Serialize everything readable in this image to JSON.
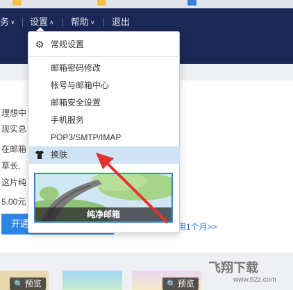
{
  "nav": {
    "items": [
      {
        "label": "务",
        "chevron": true
      },
      {
        "label": "设置",
        "chevron": true
      },
      {
        "label": "帮助",
        "chevron": true
      },
      {
        "label": "退出",
        "chevron": false
      }
    ]
  },
  "dropdown": {
    "items": [
      {
        "label": "常规设置",
        "icon": "gear-icon",
        "highlighted": false
      },
      {
        "label": "邮箱密码修改",
        "icon": "",
        "highlighted": false
      },
      {
        "label": "帐号与邮箱中心",
        "icon": "",
        "highlighted": false
      },
      {
        "label": "邮箱安全设置",
        "icon": "",
        "highlighted": false
      },
      {
        "label": "手机服务",
        "icon": "",
        "highlighted": false
      },
      {
        "label": "POP3/SMTP/IMAP",
        "icon": "",
        "highlighted": false
      },
      {
        "label": "换肤",
        "icon": "tshirt-icon",
        "highlighted": true
      }
    ],
    "skin_preview": {
      "caption": "纯净邮箱"
    }
  },
  "main": {
    "lines": [
      "理想中",
      "现实总",
      "在邮箱",
      "草长,",
      "这片纯"
    ],
    "price": "5.00元",
    "open_button": "开通",
    "trial_link": "用1个月>>"
  },
  "thumbnails": {
    "preview_label": "预览"
  },
  "watermark": {
    "logo": "飞翔下载",
    "url": "www.52z.com"
  },
  "colors": {
    "header_bg": "#1b2755",
    "highlight_row": "#cfe3f5",
    "button_blue": "#2b86e6",
    "arrow_red": "#e5322d"
  }
}
